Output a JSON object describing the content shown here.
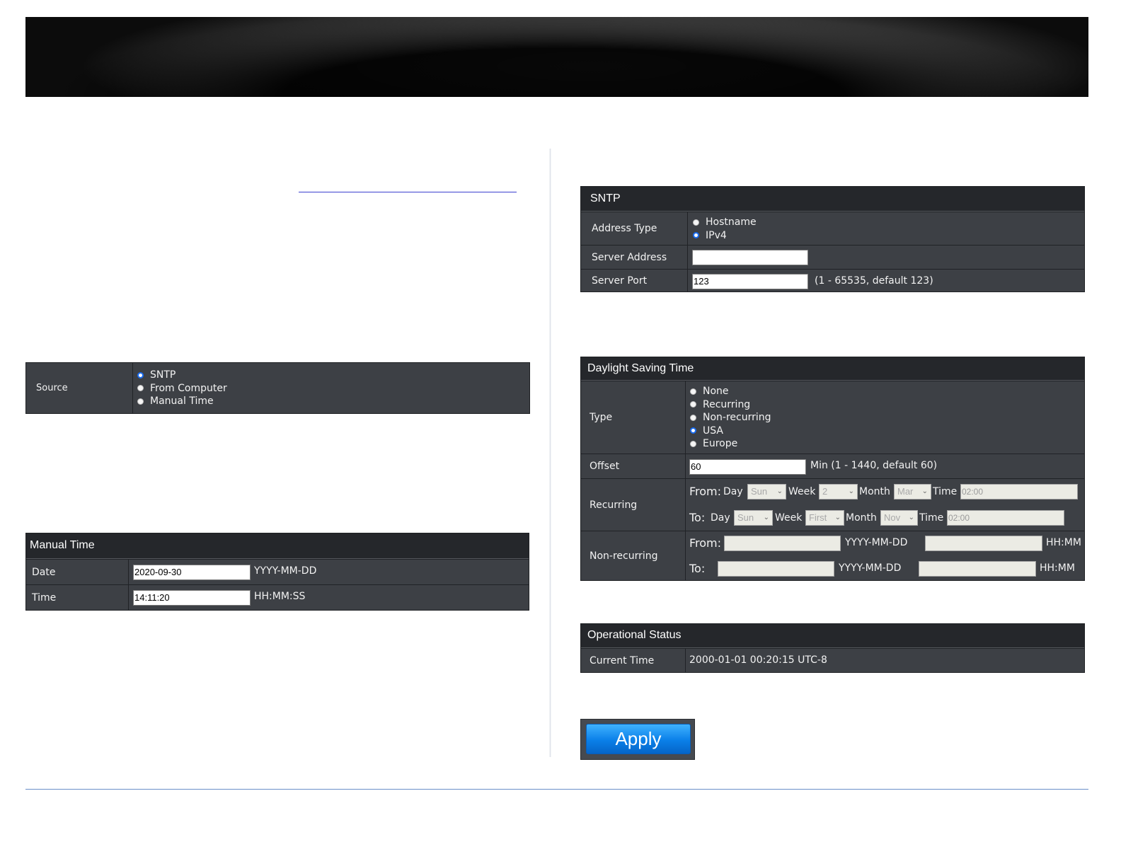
{
  "source": {
    "label": "Source",
    "options": [
      {
        "label": "SNTP",
        "selected": true
      },
      {
        "label": "From Computer",
        "selected": false
      },
      {
        "label": "Manual Time",
        "selected": false
      }
    ]
  },
  "manual_time": {
    "title": "Manual Time",
    "date_label": "Date",
    "date_value": "2020-09-30",
    "date_format": "YYYY-MM-DD",
    "time_label": "Time",
    "time_value": "14:11:20",
    "time_format": "HH:MM:SS"
  },
  "sntp": {
    "title": "SNTP",
    "address_type_label": "Address Type",
    "address_type_options": [
      {
        "label": "Hostname",
        "selected": false
      },
      {
        "label": "IPv4",
        "selected": true
      }
    ],
    "server_address_label": "Server Address",
    "server_address_value": "",
    "server_port_label": "Server Port",
    "server_port_value": "123",
    "server_port_hint": "(1 - 65535, default 123)"
  },
  "dst": {
    "title": "Daylight Saving Time",
    "type_label": "Type",
    "type_options": [
      {
        "label": "None",
        "selected": false
      },
      {
        "label": "Recurring",
        "selected": false
      },
      {
        "label": "Non-recurring",
        "selected": false
      },
      {
        "label": "USA",
        "selected": true
      },
      {
        "label": "Europe",
        "selected": false
      }
    ],
    "offset_label": "Offset",
    "offset_value": "60",
    "offset_hint": "Min (1 - 1440, default 60)",
    "recurring_label": "Recurring",
    "recurring_from": {
      "prefix": "From:",
      "day_label": "Day",
      "day_value": "Sun",
      "week_label": "Week",
      "week_value": "2",
      "month_label": "Month",
      "month_value": "Mar",
      "time_label": "Time",
      "time_value": "02:00"
    },
    "recurring_to": {
      "prefix": "To:",
      "day_label": "Day",
      "day_value": "Sun",
      "week_label": "Week",
      "week_value": "First",
      "month_label": "Month",
      "month_value": "Nov",
      "time_label": "Time",
      "time_value": "02:00"
    },
    "non_recurring_label": "Non-recurring",
    "non_recurring_from_prefix": "From:",
    "non_recurring_to_prefix": "To:",
    "date_format": "YYYY-MM-DD",
    "time_format": "HH:MM"
  },
  "operational_status": {
    "title": "Operational Status",
    "current_time_label": "Current Time",
    "current_time_value": "2000-01-01 00:20:15 UTC-8"
  },
  "apply_label": "Apply",
  "icons": {
    "radio_selected": "radio-selected-icon",
    "radio_unselected": "radio-unselected-icon",
    "dropdown": "chevron-down-icon"
  },
  "colors": {
    "panel_bg": "#3d4045",
    "panel_title_bg": "#25272b",
    "radio_accent": "#1a6cf0",
    "apply_button": "#0a7fe8",
    "link_underline": "#3b3fd0",
    "footer_rule": "#6a8fc9"
  }
}
